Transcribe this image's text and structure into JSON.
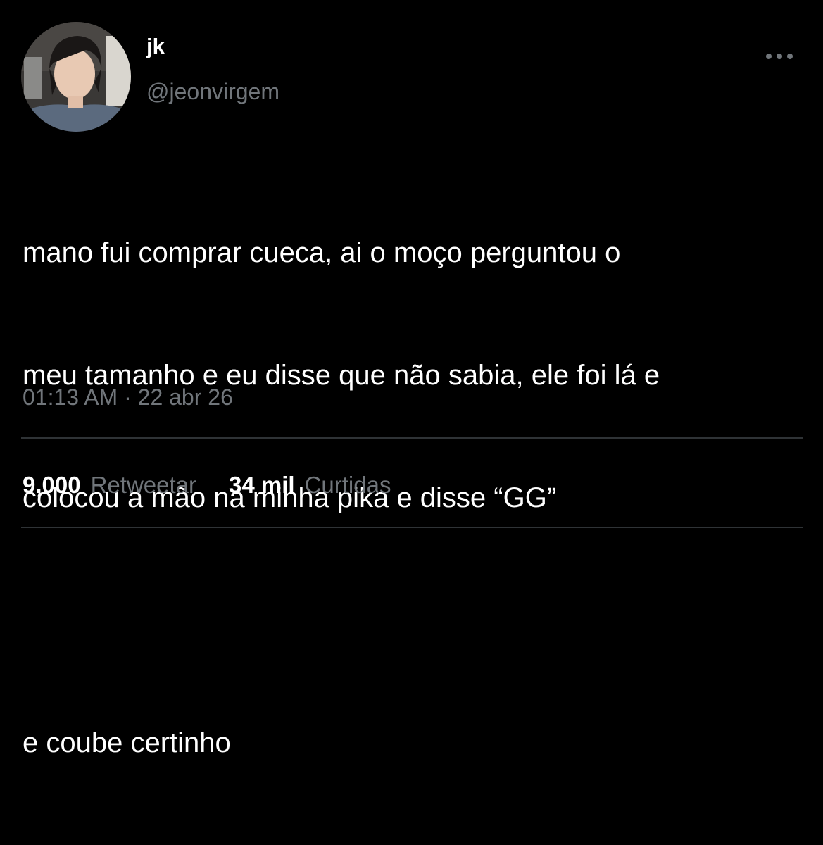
{
  "user": {
    "display_name": "jk",
    "handle": "@jeonvirgem",
    "avatar_icon": "profile-photo"
  },
  "tweet": {
    "text_lines": [
      "mano fui comprar cueca, ai o moço perguntou o",
      "meu tamanho e eu disse que não sabia, ele foi lá e",
      "colocou a mão na minha pika e disse “GG”"
    ],
    "text_tail": "e coube certinho",
    "time": "01:13 AM",
    "separator": "·",
    "date": "22 abr 26"
  },
  "stats": {
    "retweets_count": "9,000",
    "retweets_label": "Retweetar",
    "likes_count": "34 mil",
    "likes_label": "Curtidas"
  },
  "icons": {
    "more": "more-options-icon"
  },
  "colors": {
    "background": "#000000",
    "text": "#ffffff",
    "secondary": "#71767b",
    "divider": "#2f3336"
  }
}
